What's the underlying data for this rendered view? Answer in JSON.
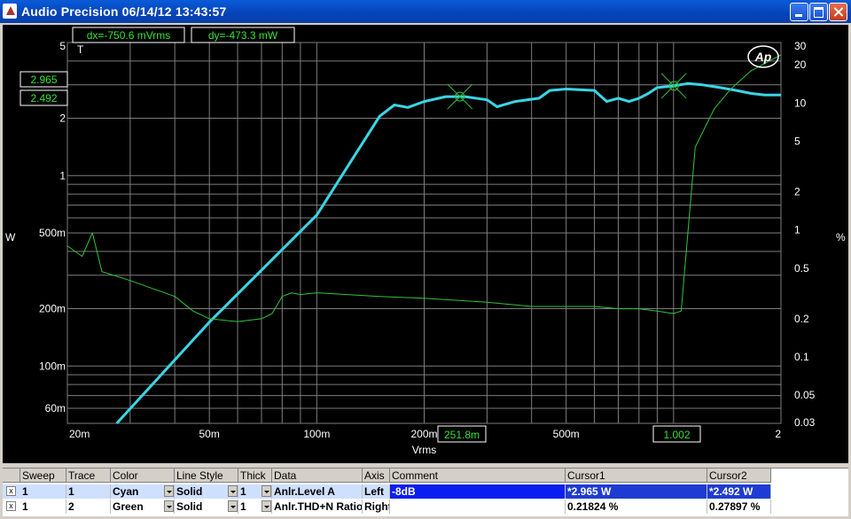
{
  "window": {
    "title": "Audio Precision  06/14/12 13:43:57"
  },
  "colors": {
    "cyan": "#3ad6e6",
    "green": "#2fc43a",
    "grid": "#7d7d7d",
    "label": "#ffffff",
    "accent_label": "#34e234",
    "selection": "#0a1ef0"
  },
  "cursor_readouts": {
    "dx": "dx=-750.6  mVrms",
    "dy": "dy=-473.3  mW",
    "y_cursor1": "2.965",
    "y_cursor2": "2.492",
    "x_cursor1": "251.8m",
    "x_cursor2": "1.002",
    "trigger_marker": "T",
    "ap_logo": "Ap"
  },
  "chart_data": {
    "type": "line",
    "xlabel": "Vrms",
    "ylabel": "W",
    "ylabel_right": "%",
    "x_scale": "log",
    "y_scale": "log",
    "y2_scale": "log",
    "grid": true,
    "xlim": [
      0.02,
      2
    ],
    "ylim": [
      0.05,
      5
    ],
    "y2lim": [
      0.03,
      30
    ],
    "x_tick_labels": [
      "20m",
      "50m",
      "100m",
      "200m",
      "500m",
      "2"
    ],
    "x_tick_values": [
      0.02,
      0.05,
      0.1,
      0.2,
      0.5,
      2
    ],
    "y_tick_labels": [
      "5",
      "2",
      "1",
      "500m",
      "200m",
      "100m",
      "60m"
    ],
    "y_tick_values": [
      5,
      2,
      1,
      0.5,
      0.2,
      0.1,
      0.06
    ],
    "y2_tick_labels": [
      "30",
      "20",
      "10",
      "5",
      "2",
      "1",
      "0.5",
      "0.2",
      "0.1",
      "0.05",
      "0.03"
    ],
    "y2_tick_values": [
      30,
      20,
      10,
      5,
      2,
      1,
      0.5,
      0.2,
      0.1,
      0.05,
      0.03
    ],
    "series": [
      {
        "axis": "left",
        "color": "cyan",
        "x": [
          0.0275,
          0.05,
          0.1,
          0.15,
          0.165,
          0.18,
          0.2,
          0.23,
          0.26,
          0.3,
          0.32,
          0.36,
          0.42,
          0.45,
          0.5,
          0.6,
          0.65,
          0.7,
          0.75,
          0.8,
          0.85,
          0.9,
          1.0,
          1.1,
          1.2,
          1.35,
          1.5,
          1.65,
          1.8,
          2.0
        ],
        "y": [
          0.05,
          0.17,
          0.62,
          2.05,
          2.35,
          2.28,
          2.45,
          2.6,
          2.6,
          2.5,
          2.3,
          2.45,
          2.55,
          2.8,
          2.85,
          2.8,
          2.45,
          2.55,
          2.45,
          2.55,
          2.7,
          2.9,
          2.96,
          3.05,
          3.0,
          2.9,
          2.8,
          2.7,
          2.65,
          2.65
        ]
      },
      {
        "axis": "right",
        "color": "green",
        "x": [
          0.02,
          0.022,
          0.0235,
          0.025,
          0.03,
          0.04,
          0.045,
          0.05,
          0.06,
          0.07,
          0.075,
          0.08,
          0.085,
          0.09,
          0.1,
          0.15,
          0.2,
          0.3,
          0.4,
          0.5,
          0.6,
          0.7,
          0.8,
          0.9,
          1.0,
          1.05,
          1.15,
          1.3,
          1.45,
          1.65,
          2.0
        ],
        "y": [
          0.75,
          0.62,
          0.95,
          0.47,
          0.4,
          0.3,
          0.23,
          0.2,
          0.19,
          0.2,
          0.22,
          0.3,
          0.32,
          0.31,
          0.32,
          0.3,
          0.29,
          0.27,
          0.25,
          0.25,
          0.25,
          0.24,
          0.24,
          0.23,
          0.22,
          0.23,
          4.5,
          9.0,
          13.0,
          18.0,
          24.0
        ]
      }
    ]
  },
  "table": {
    "headers": [
      "Sweep",
      "Trace",
      "Color",
      "Line Style",
      "Thick",
      "Data",
      "Axis",
      "Comment",
      "Cursor1",
      "Cursor2"
    ],
    "rows": [
      {
        "checked": "x",
        "sweep": "1",
        "trace": "1",
        "color": "Cyan",
        "line_style": "Solid",
        "thick": "1",
        "data": "Anlr.Level A",
        "axis": "Left",
        "comment": "-8dB",
        "cursor1": "*2.965   W",
        "cursor2": "*2.492   W",
        "selected": true
      },
      {
        "checked": "x",
        "sweep": "1",
        "trace": "2",
        "color": "Green",
        "line_style": "Solid",
        "thick": "1",
        "data": "Anlr.THD+N Ratio",
        "axis": "Right",
        "comment": "",
        "cursor1": "0.21824  %",
        "cursor2": "0.27897  %",
        "selected": false
      }
    ]
  }
}
